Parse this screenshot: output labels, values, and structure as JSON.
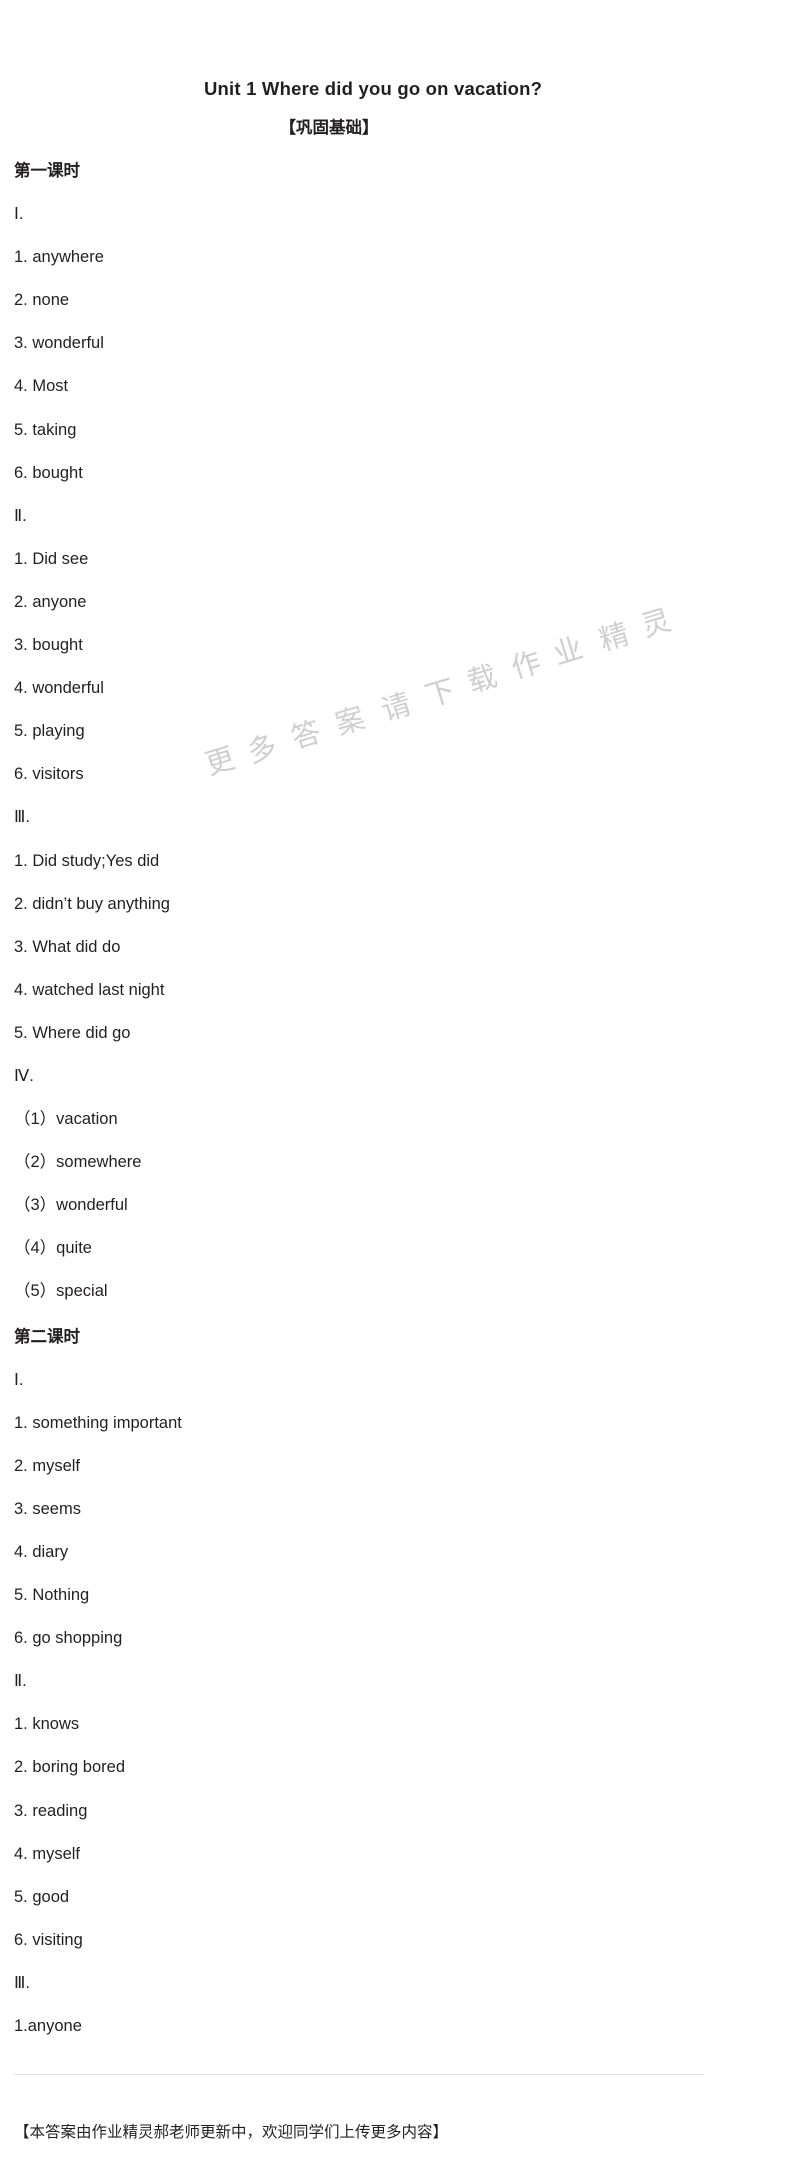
{
  "document": {
    "title": "Unit 1  Where did you go on vacation?",
    "subtitle": "【巩固基础】",
    "watermark_text": "更多答案请下载作业精灵",
    "footer_note": "【本答案由作业精灵郝老师更新中，欢迎同学们上传更多内容】"
  },
  "sections": [
    {
      "heading": "第一课时",
      "groups": [
        {
          "roman": "Ⅰ.",
          "items": [
            "1. anywhere",
            "2. none",
            "3. wonderful",
            "4. Most",
            "5. taking",
            "6. bought"
          ]
        },
        {
          "roman": "Ⅱ.",
          "items": [
            "1. Did  see",
            "2. anyone",
            "3. bought",
            "4. wonderful",
            "5. playing",
            "6. visitors"
          ]
        },
        {
          "roman": "Ⅲ.",
          "items": [
            "1. Did study;Yes  did",
            "2. didn’t buy anything",
            "3. What did do",
            "4. watched last night",
            "5. Where did go"
          ]
        },
        {
          "roman": "Ⅳ.",
          "items": [
            "（1）vacation",
            "（2）somewhere",
            "（3）wonderful",
            "（4）quite",
            "（5）special"
          ]
        }
      ]
    },
    {
      "heading": "第二课时",
      "groups": [
        {
          "roman": "Ⅰ.",
          "items": [
            "1. something important",
            "2. myself",
            "3. seems",
            "4. diary",
            "5. Nothing",
            "6. go shopping"
          ]
        },
        {
          "roman": "Ⅱ.",
          "items": [
            "1. knows",
            "2. boring bored",
            "3. reading",
            "4. myself",
            "5. good",
            "6. visiting"
          ]
        },
        {
          "roman": "Ⅲ.",
          "items": [
            "1.anyone"
          ]
        }
      ]
    }
  ]
}
